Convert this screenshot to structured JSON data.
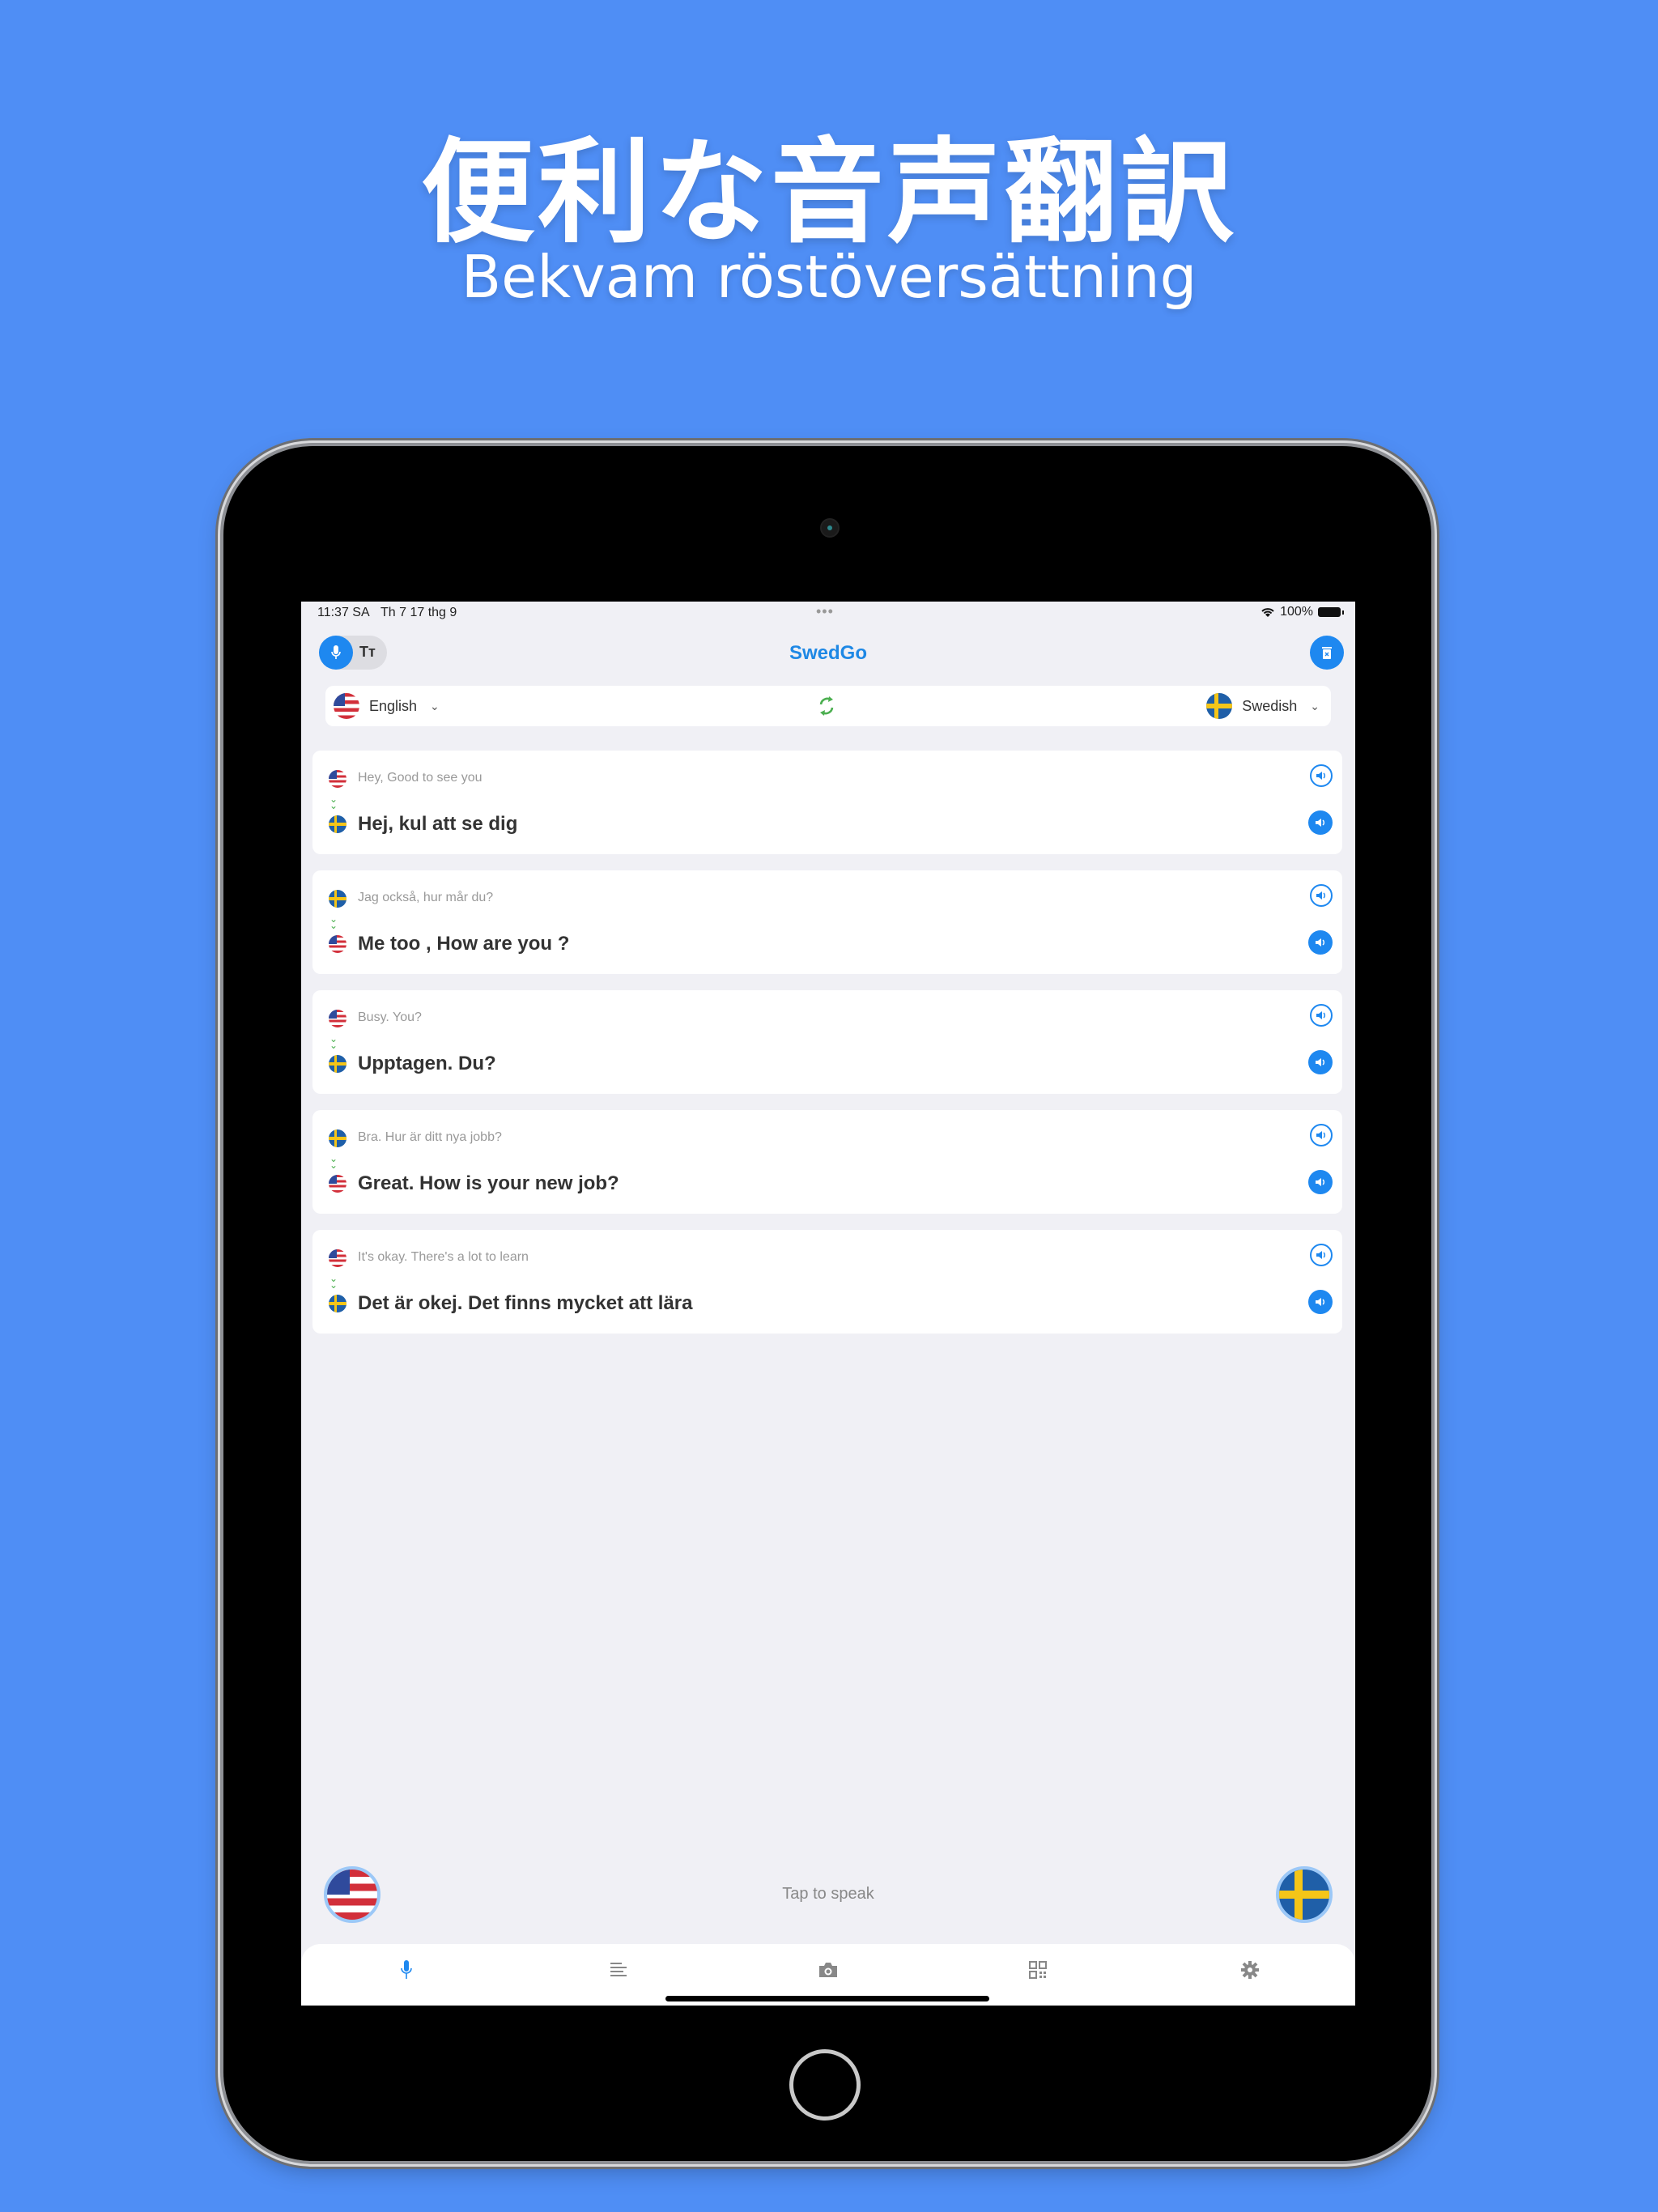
{
  "promo": {
    "headline": "便利な音声翻訳",
    "subheadline": "Bekvam röstöversättning"
  },
  "status_bar": {
    "time": "11:37 SA",
    "date": "Th 7 17 thg 9",
    "battery": "100%"
  },
  "header": {
    "title": "SwedGo",
    "mode_toggle": {
      "active": "voice",
      "text_mode_label": "Tт"
    }
  },
  "language_bar": {
    "source": {
      "label": "English",
      "flag": "us"
    },
    "target": {
      "label": "Swedish",
      "flag": "se"
    }
  },
  "colors": {
    "background": "#4f8ef5",
    "accent": "#1e88f0",
    "arrow": "#4caf50"
  },
  "conversations": [
    {
      "source_flag": "us",
      "source_text": "Hey,  Good to see you",
      "target_flag": "se",
      "target_text": "Hej, kul att se dig"
    },
    {
      "source_flag": "se",
      "source_text": "Jag också, hur mår du?",
      "target_flag": "us",
      "target_text": "Me too , How are you ?"
    },
    {
      "source_flag": "us",
      "source_text": "Busy. You?",
      "target_flag": "se",
      "target_text": "Upptagen. Du?"
    },
    {
      "source_flag": "se",
      "source_text": "Bra. Hur är ditt nya jobb?",
      "target_flag": "us",
      "target_text": "Great. How is your new job?"
    },
    {
      "source_flag": "us",
      "source_text": "It's okay. There's a lot to learn",
      "target_flag": "se",
      "target_text": "Det är okej. Det finns mycket att lära"
    }
  ],
  "speak": {
    "label": "Tap to speak",
    "left_flag": "us",
    "right_flag": "se"
  },
  "tabs": [
    {
      "icon": "mic-icon",
      "active": true
    },
    {
      "icon": "text-icon",
      "active": false
    },
    {
      "icon": "camera-icon",
      "active": false
    },
    {
      "icon": "qr-icon",
      "active": false
    },
    {
      "icon": "gear-icon",
      "active": false
    }
  ]
}
